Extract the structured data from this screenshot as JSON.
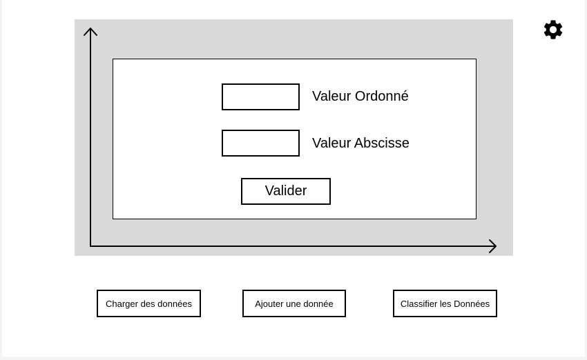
{
  "header": {
    "settings_icon": "gear-icon"
  },
  "form": {
    "ordinate_label": "Valeur Ordonné",
    "abscissa_label": "Valeur Abscisse",
    "ordinate_value": "",
    "abscissa_value": "",
    "validate_label": "Valider"
  },
  "actions": {
    "load_label": "Charger des données",
    "add_label": "Ajouter une donnée",
    "classify_label": "Classifier les Données"
  },
  "colors": {
    "plot_background": "#d9d9d9",
    "page_background": "#ffffff",
    "stroke": "#000000"
  }
}
